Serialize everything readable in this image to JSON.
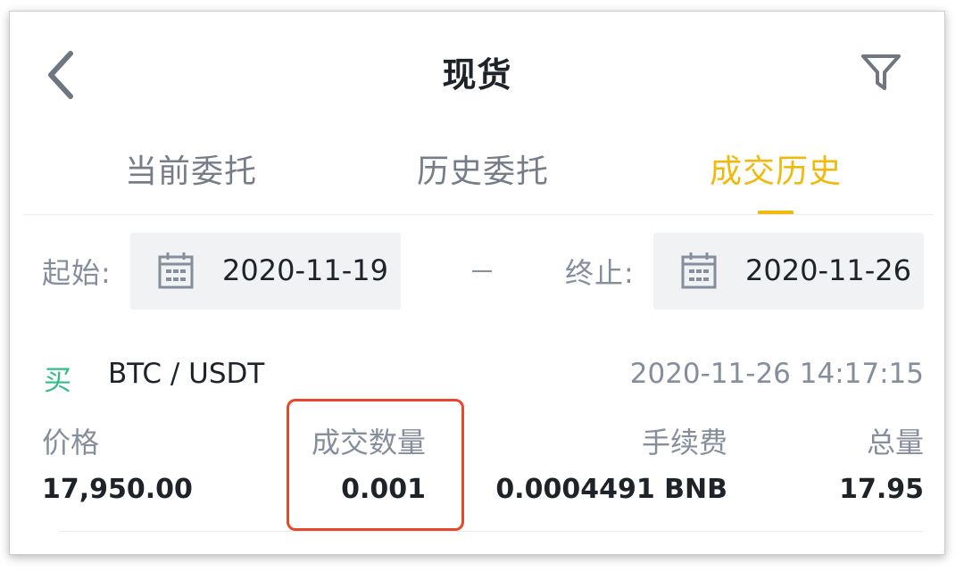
{
  "header": {
    "title": "现货"
  },
  "tabs": [
    {
      "label": "当前委托",
      "active": false
    },
    {
      "label": "历史委托",
      "active": false
    },
    {
      "label": "成交历史",
      "active": true
    }
  ],
  "date_range": {
    "start_label": "起始:",
    "start_value": "2020-11-19",
    "separator": "–",
    "end_label": "终止:",
    "end_value": "2020-11-26"
  },
  "trade": {
    "side": "买",
    "pair": "BTC / USDT",
    "time": "2020-11-26 14:17:15",
    "columns": [
      {
        "label": "价格",
        "value": "17,950.00"
      },
      {
        "label": "成交数量",
        "value": "0.001"
      },
      {
        "label": "手续费",
        "value": "0.0004491 BNB"
      },
      {
        "label": "总量",
        "value": "17.95"
      }
    ]
  },
  "colors": {
    "accent": "#f0b90b",
    "buy": "#2ebd85",
    "highlight": "#e8472a",
    "text_primary": "#1e2329",
    "text_secondary": "#848e9c"
  },
  "icons": {
    "back": "chevron-left-icon",
    "filter": "filter-icon",
    "calendar": "calendar-icon"
  }
}
